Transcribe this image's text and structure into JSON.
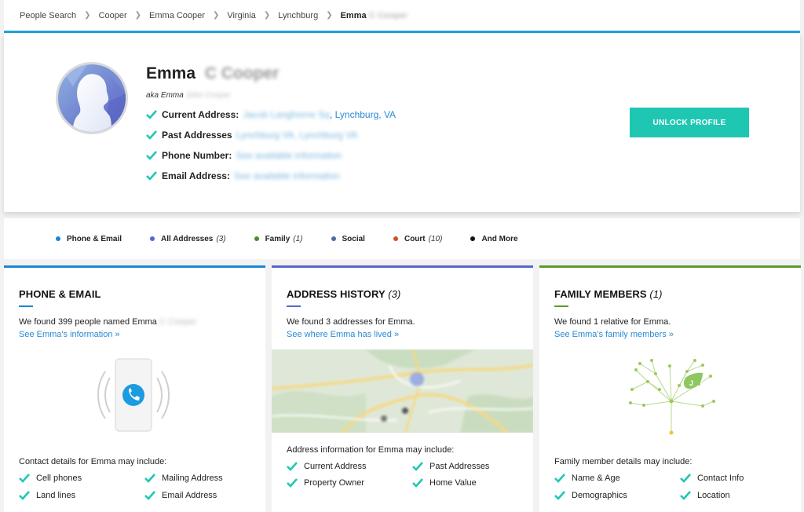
{
  "breadcrumb": [
    "People Search",
    "Cooper",
    "Emma Cooper",
    "Virginia",
    "Lynchburg"
  ],
  "breadcrumb_current": "Emma",
  "breadcrumb_current_blur": "C Cooper",
  "profile": {
    "first_name": "Emma",
    "last_name_blur": "C Cooper",
    "aka_label": "aka Emma",
    "aka_blur": "John Cooper",
    "rows": [
      {
        "label": "Current Address:",
        "blur": "Jacob Langhorne Sq",
        "val": ", Lynchburg, VA"
      },
      {
        "label": "Past Addresses",
        "blur": "Lynchburg VA, Lynchburg VA",
        "val": ""
      },
      {
        "label": "Phone Number:",
        "blur": "See available information",
        "val": ""
      },
      {
        "label": "Email Address:",
        "blur": "See available information",
        "val": ""
      }
    ],
    "unlock_label": "UNLOCK PROFILE"
  },
  "tabs": [
    {
      "label": "Phone & Email",
      "count": "",
      "color": "#1b87d4"
    },
    {
      "label": "All Addresses",
      "count": "(3)",
      "color": "#5566cc"
    },
    {
      "label": "Family",
      "count": "(1)",
      "color": "#4d8a2a"
    },
    {
      "label": "Social",
      "count": "",
      "color": "#4d6aa8"
    },
    {
      "label": "Court",
      "count": "(10)",
      "color": "#d0521e"
    },
    {
      "label": "And More",
      "count": "",
      "color": "#111111"
    }
  ],
  "cards": {
    "phone": {
      "title": "PHONE & EMAIL",
      "found": "We found 399 people named Emma",
      "found_blur": "C Cooper",
      "link": "See Emma's information »",
      "may": "Contact details for Emma may include:",
      "features": [
        "Cell phones",
        "Mailing Address",
        "Land lines",
        "Email Address"
      ],
      "accent": "#1b87d4"
    },
    "address": {
      "title": "ADDRESS HISTORY",
      "count": "(3)",
      "found": "We found 3 addresses for Emma.",
      "link": "See where Emma has lived »",
      "may": "Address information for Emma may include:",
      "features": [
        "Current Address",
        "Past Addresses",
        "Property Owner",
        "Home Value"
      ],
      "accent": "#5566cc"
    },
    "family": {
      "title": "FAMILY MEMBERS",
      "count": "(1)",
      "found": "We found 1 relative for Emma.",
      "link": "See Emma's family members »",
      "may": "Family member details may include:",
      "features": [
        "Name & Age",
        "Contact Info",
        "Demographics",
        "Location"
      ],
      "accent": "#5a9a2e"
    }
  },
  "colors": {
    "check": "#1fc7b3",
    "link": "#2a8ad3",
    "unlock": "#1fc7b3",
    "breadcrumb_rule": "#1ea2e0"
  },
  "icons": [
    "chevron-right-icon",
    "check-icon",
    "phone-icon",
    "family-tree-icon",
    "map-pin-icon"
  ]
}
